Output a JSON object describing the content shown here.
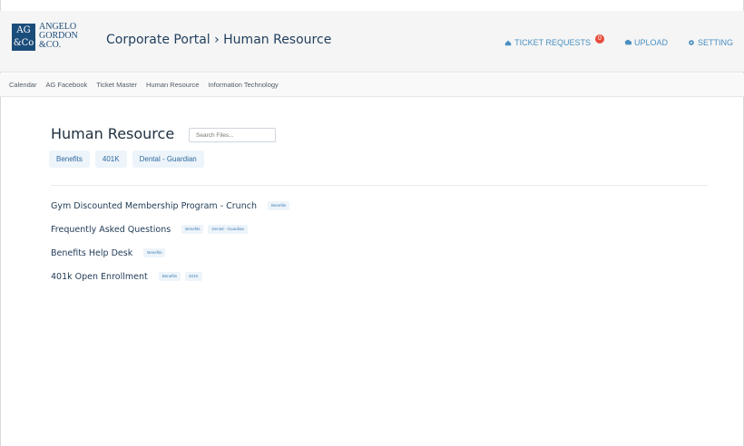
{
  "logo": {
    "mark": "AG\n&Co",
    "text": "ANGELO\nGORDON\n&CO."
  },
  "header": {
    "title": "Corporate Portal › Human Resource",
    "actions": {
      "tickets_label": "TICKET REQUESTS",
      "tickets_badge": "0",
      "upload_label": "UPLOAD",
      "setting_label": "SETTING"
    }
  },
  "subnav": {
    "items": [
      "Calendar",
      "AG Facebook",
      "Ticket Master",
      "Human Resource",
      "Information Technology"
    ]
  },
  "main": {
    "title": "Human Resource",
    "search_placeholder": "Search Files...",
    "tags": [
      "Benefits",
      "401K",
      "Dental - Guardian"
    ],
    "documents": [
      {
        "title": "Gym Discounted Membership Program - Crunch",
        "tags": [
          "Benefits"
        ]
      },
      {
        "title": "Frequently Asked Questions",
        "tags": [
          "Benefits",
          "Dental - Guardian"
        ]
      },
      {
        "title": "Benefits Help Desk",
        "tags": [
          "Benefits"
        ]
      },
      {
        "title": "401k Open Enrollment",
        "tags": [
          "Benefits",
          "401K"
        ]
      }
    ]
  },
  "colors": {
    "brand": "#1b4d7a",
    "accent": "#4a90c2",
    "badge": "#e74c3c",
    "tag_bg": "#edf4fa"
  }
}
